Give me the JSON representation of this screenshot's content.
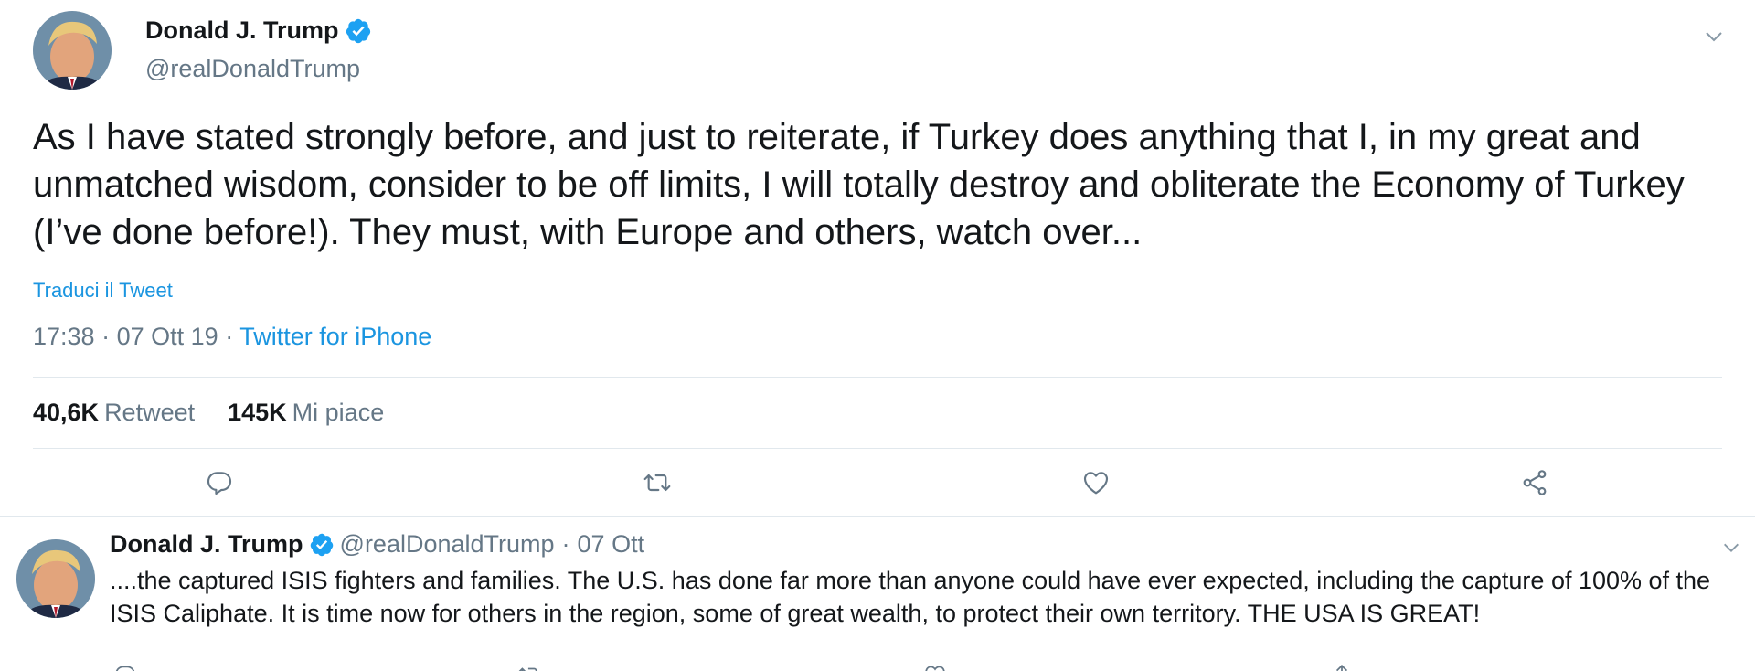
{
  "main_tweet": {
    "author_name": "Donald J. Trump",
    "handle": "@realDonaldTrump",
    "text": "As I have stated strongly before, and just to reiterate, if Turkey does anything that I, in my great and unmatched wisdom, consider to be off limits, I will totally destroy and obliterate the Economy of Turkey (I’ve done before!). They must, with Europe and others, watch over...",
    "translate_label": "Traduci il Tweet",
    "time": "17:38",
    "date": "07 Ott 19",
    "separator": "·",
    "source": "Twitter for iPhone",
    "retweets_count": "40,6K",
    "retweets_label": "Retweet",
    "likes_count": "145K",
    "likes_label": "Mi piace"
  },
  "reply_tweet": {
    "author_name": "Donald J. Trump",
    "handle": "@realDonaldTrump",
    "separator": "·",
    "date": "07 Ott",
    "text": "....the captured ISIS fighters and families. The U.S. has done far more than anyone could have ever expected, including the capture of 100% of the ISIS Caliphate. It is time now for others in the region, some of great wealth, to protect their own territory. THE USA IS GREAT!"
  },
  "colors": {
    "link": "#1b95e0",
    "secondary_text": "#657786",
    "divider": "#e1e8ed",
    "verified": "#1da1f2"
  },
  "icons": [
    "verified-badge-icon",
    "chevron-down-icon",
    "reply-icon",
    "retweet-icon",
    "like-icon",
    "share-icon"
  ]
}
